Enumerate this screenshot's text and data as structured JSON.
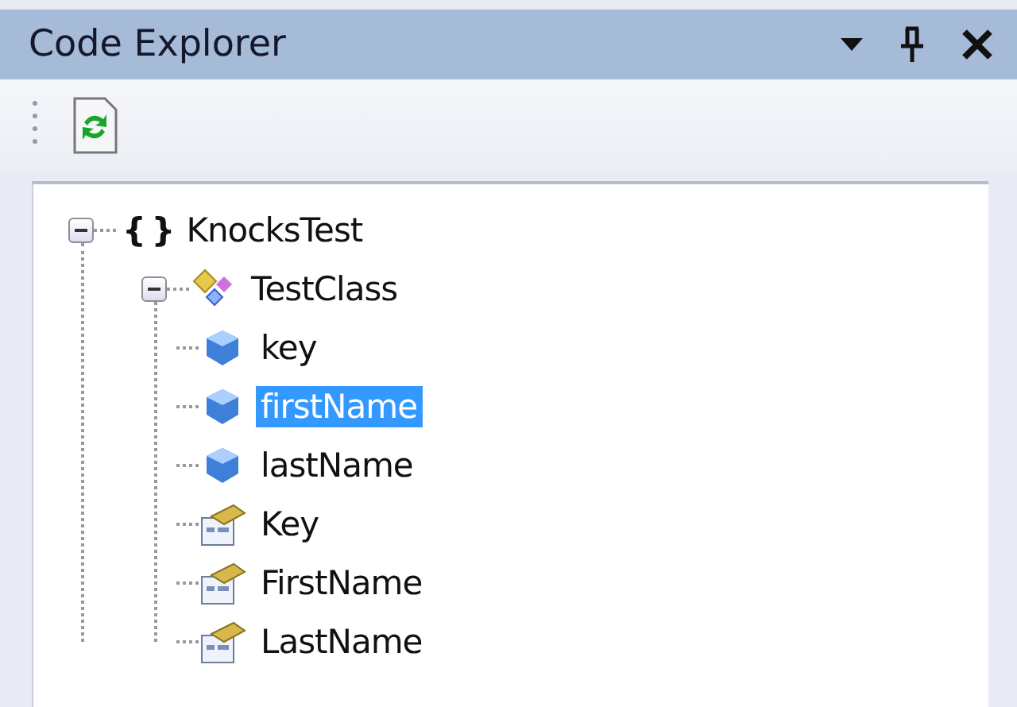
{
  "window": {
    "title": "Code Explorer"
  },
  "tree": [
    {
      "kind": "namespace",
      "icon_text": "{ }",
      "label": "KnocksTest",
      "expanded": true,
      "selected": false,
      "children": [
        {
          "kind": "class",
          "label": "TestClass",
          "expanded": true,
          "selected": false,
          "children": [
            {
              "kind": "field",
              "label": "key",
              "selected": false
            },
            {
              "kind": "field",
              "label": "firstName",
              "selected": true
            },
            {
              "kind": "field",
              "label": "lastName",
              "selected": false
            },
            {
              "kind": "property",
              "label": "Key",
              "selected": false
            },
            {
              "kind": "property",
              "label": "FirstName",
              "selected": false
            },
            {
              "kind": "property",
              "label": "LastName",
              "selected": false
            }
          ]
        }
      ]
    }
  ]
}
